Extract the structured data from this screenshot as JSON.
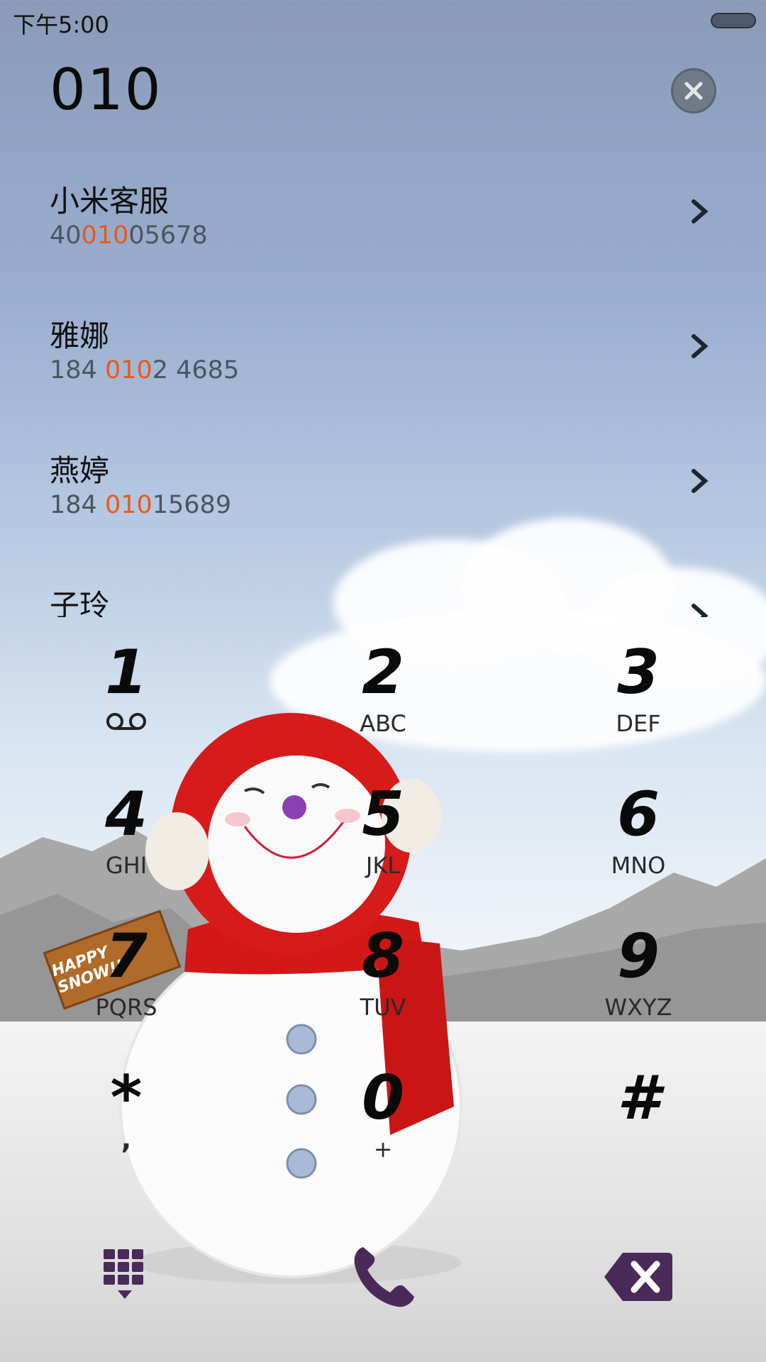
{
  "status_bar": {
    "time": "下午5:00"
  },
  "dialer": {
    "dialed_number": "010"
  },
  "contacts": [
    {
      "name": "小米客服",
      "number_parts": [
        "40",
        "010",
        "05678"
      ]
    },
    {
      "name": "雅娜",
      "number_parts": [
        "184 ",
        "010",
        "2 4685"
      ]
    },
    {
      "name": "燕婷",
      "number_parts": [
        "184 ",
        "010",
        "15689"
      ]
    },
    {
      "name": "子玲",
      "number_parts": [
        "",
        "",
        ""
      ]
    }
  ],
  "keypad": [
    {
      "digit": "1",
      "letters": ""
    },
    {
      "digit": "2",
      "letters": "ABC"
    },
    {
      "digit": "3",
      "letters": "DEF"
    },
    {
      "digit": "4",
      "letters": "GHI"
    },
    {
      "digit": "5",
      "letters": "JKL"
    },
    {
      "digit": "6",
      "letters": "MNO"
    },
    {
      "digit": "7",
      "letters": "PQRS"
    },
    {
      "digit": "8",
      "letters": "TUV"
    },
    {
      "digit": "9",
      "letters": "WXYZ"
    },
    {
      "digit": "*",
      "letters": ","
    },
    {
      "digit": "0",
      "letters": "+"
    },
    {
      "digit": "#",
      "letters": ""
    }
  ],
  "decor": {
    "sign_text": "HAPPY SNOW!!"
  },
  "colors": {
    "highlight": "#e85a18",
    "action_purple": "#4a2a58"
  },
  "icons": {
    "voicemail": "voicemail-icon",
    "clear": "clear-x-icon",
    "chevron": "chevron-right-icon",
    "keypad_toggle": "dialpad-icon",
    "call": "phone-icon",
    "backspace": "backspace-icon"
  }
}
